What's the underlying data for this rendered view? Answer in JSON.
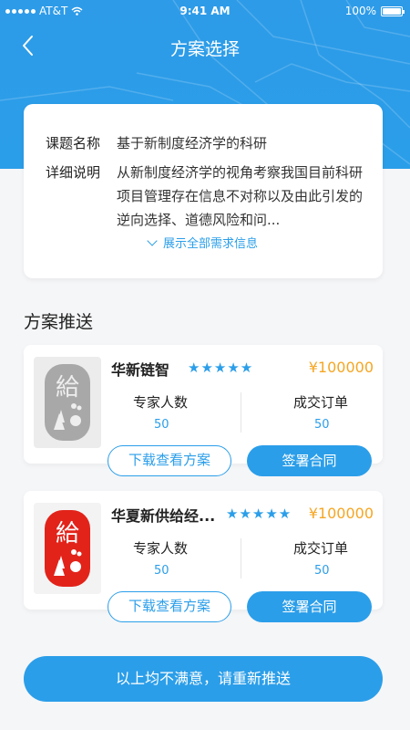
{
  "status_bar": {
    "carrier": "AT&T",
    "time": "9:41 AM",
    "battery": "100%"
  },
  "nav": {
    "title": "方案选择"
  },
  "topic": {
    "name_label": "课题名称",
    "name_value": "基于新制度经济学的科研",
    "desc_label": "详细说明",
    "desc_value": "从新制度经济学的视角考察我国目前科研项目管理存在信息不对称以及由此引发的逆向选择、道德风险和问...",
    "expand_label": "展示全部需求信息"
  },
  "section": {
    "title": "方案推送"
  },
  "plans": [
    {
      "name": "华新链智",
      "stars": "★★★★★",
      "price": "¥100000",
      "experts_label": "专家人数",
      "experts_value": "50",
      "orders_label": "成交订单",
      "orders_value": "50",
      "download_label": "下载查看方案",
      "sign_label": "签署合同",
      "seal_color": "#9a9a9a"
    },
    {
      "name": "华夏新供给经...",
      "stars": "★★★★★",
      "price": "¥100000",
      "experts_label": "专家人数",
      "experts_value": "50",
      "orders_label": "成交订单",
      "orders_value": "50",
      "download_label": "下载查看方案",
      "sign_label": "签署合同",
      "seal_color": "#e2231a"
    }
  ],
  "footer": {
    "repush_label": "以上均不满意，请重新推送"
  },
  "colors": {
    "primary": "#2b9ee9",
    "price": "#f5a623"
  }
}
